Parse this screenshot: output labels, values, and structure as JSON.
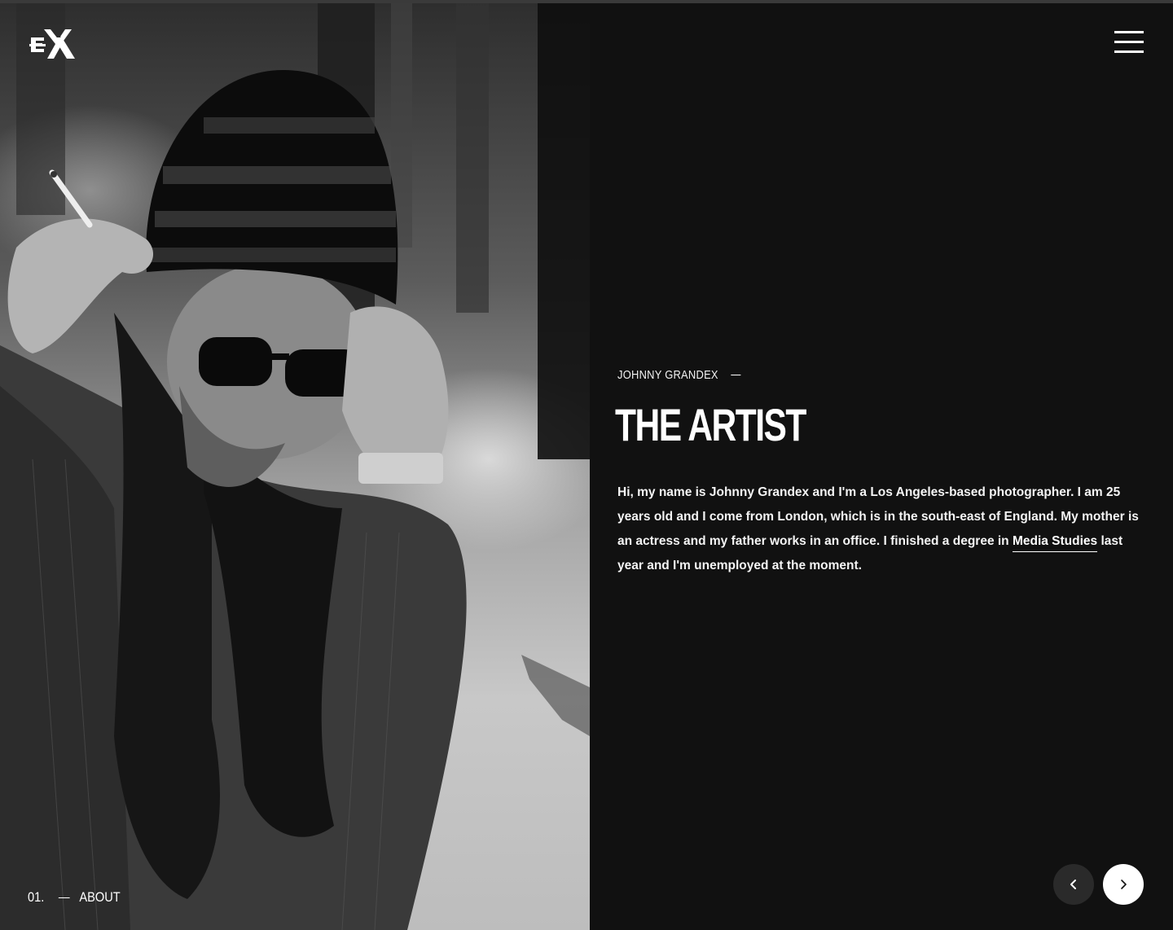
{
  "brand": {
    "logo_icon": "ex-monogram-logo"
  },
  "header": {
    "menu_icon": "hamburger-menu-icon"
  },
  "hero": {
    "eyebrow": "Johnny Grandex",
    "title": "THE ARTIST",
    "bio_before_link": "Hi, my name is Johnny Grandex and I'm a Los Angeles-based photographer. I am 25 years old and I come from London, which is in the south-east of England. My mother is an actress and my father works in an office. I finished a degree in ",
    "bio_link": "Media Studies",
    "bio_after_link": " last year and I'm unemployed at the moment."
  },
  "section": {
    "number": "01.",
    "label": "About"
  },
  "navigation": {
    "prev_icon": "chevron-left-icon",
    "next_icon": "chevron-right-icon"
  },
  "colors": {
    "background": "#111111",
    "text": "#ffffff",
    "prev_button": "#2a2a2a",
    "next_button": "#ffffff"
  }
}
